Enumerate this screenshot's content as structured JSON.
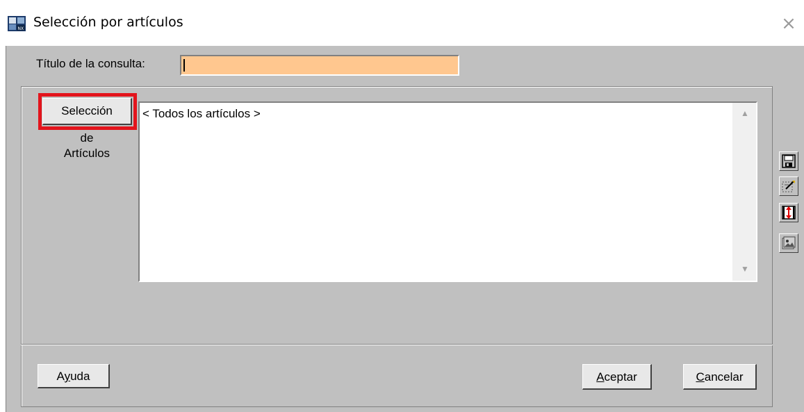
{
  "window": {
    "title": "Selección por artículos",
    "close_glyph": "×"
  },
  "query": {
    "label": "Título de la consulta:",
    "value": ""
  },
  "selection": {
    "button_label": "Selección",
    "caption_line1": "de",
    "caption_line2": "Artículos",
    "highlight_color": "#e3141c"
  },
  "list": {
    "items": [
      "< Todos los artículos >"
    ]
  },
  "toolbar": {
    "icons": [
      "save-icon",
      "edit-icon",
      "resize-icon",
      "gallery-icon"
    ]
  },
  "footer": {
    "help": {
      "prefix": "A",
      "mnemonic": "y",
      "suffix": "uda"
    },
    "accept": {
      "prefix": "",
      "mnemonic": "A",
      "suffix": "ceptar"
    },
    "cancel": {
      "prefix": "",
      "mnemonic": "C",
      "suffix": "ancelar"
    }
  },
  "colors": {
    "input_background": "#ffc78f",
    "dialog_background": "#c0c0c0"
  }
}
